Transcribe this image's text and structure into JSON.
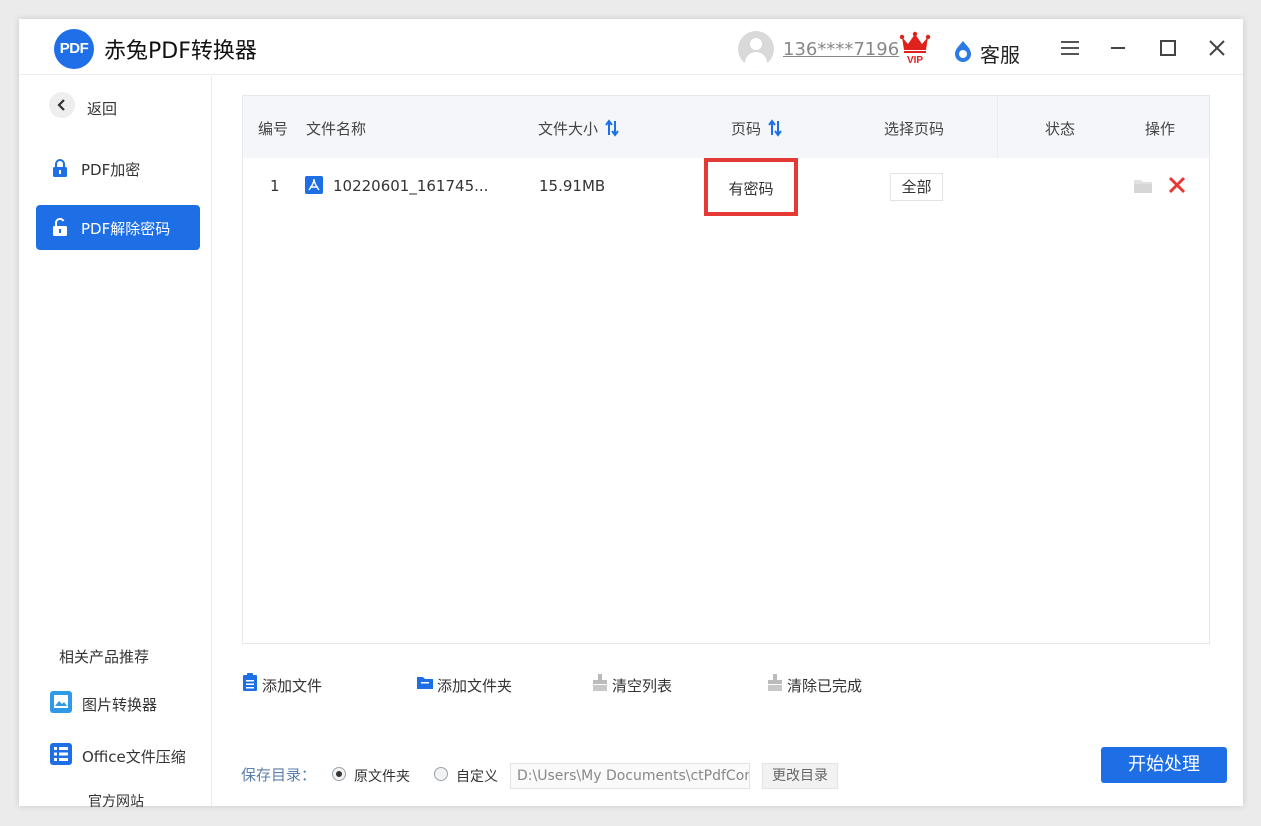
{
  "app": {
    "title": "赤兔PDF转换器",
    "logo_text": "PDF",
    "username": "136****7196",
    "vip_label": "VIP",
    "service_label": "客服"
  },
  "colors": {
    "primary": "#1e6fe6",
    "highlight_border": "#e53935",
    "delete_red": "#e53935"
  },
  "sidebar": {
    "back_label": "返回",
    "items": [
      {
        "label": "PDF加密",
        "icon": "lock-icon",
        "active": false
      },
      {
        "label": "PDF解除密码",
        "icon": "unlock-icon",
        "active": true
      }
    ],
    "recommend_title": "相关产品推荐",
    "recommend_items": [
      {
        "label": "图片转换器",
        "icon": "image-converter-icon"
      },
      {
        "label": "Office文件压缩",
        "icon": "office-compress-icon"
      }
    ],
    "site_link": "官方网站"
  },
  "table": {
    "headers": {
      "index": "编号",
      "filename": "文件名称",
      "filesize": "文件大小",
      "pages": "页码",
      "select_pages": "选择页码",
      "status": "状态",
      "actions": "操作"
    },
    "rows": [
      {
        "index": "1",
        "filename": "10220601_161745...",
        "filesize": "15.91MB",
        "pages": "有密码",
        "select_pages": "全部",
        "status": ""
      }
    ]
  },
  "toolbar": {
    "add_file": "添加文件",
    "add_folder": "添加文件夹",
    "clear_list": "清空列表",
    "clear_done": "清除已完成"
  },
  "footer": {
    "save_label": "保存目录：",
    "option_original": "原文件夹",
    "option_custom": "自定义",
    "path_value": "D:\\Users\\My Documents\\ctPdfCon",
    "change_dir": "更改目录",
    "start": "开始处理"
  }
}
